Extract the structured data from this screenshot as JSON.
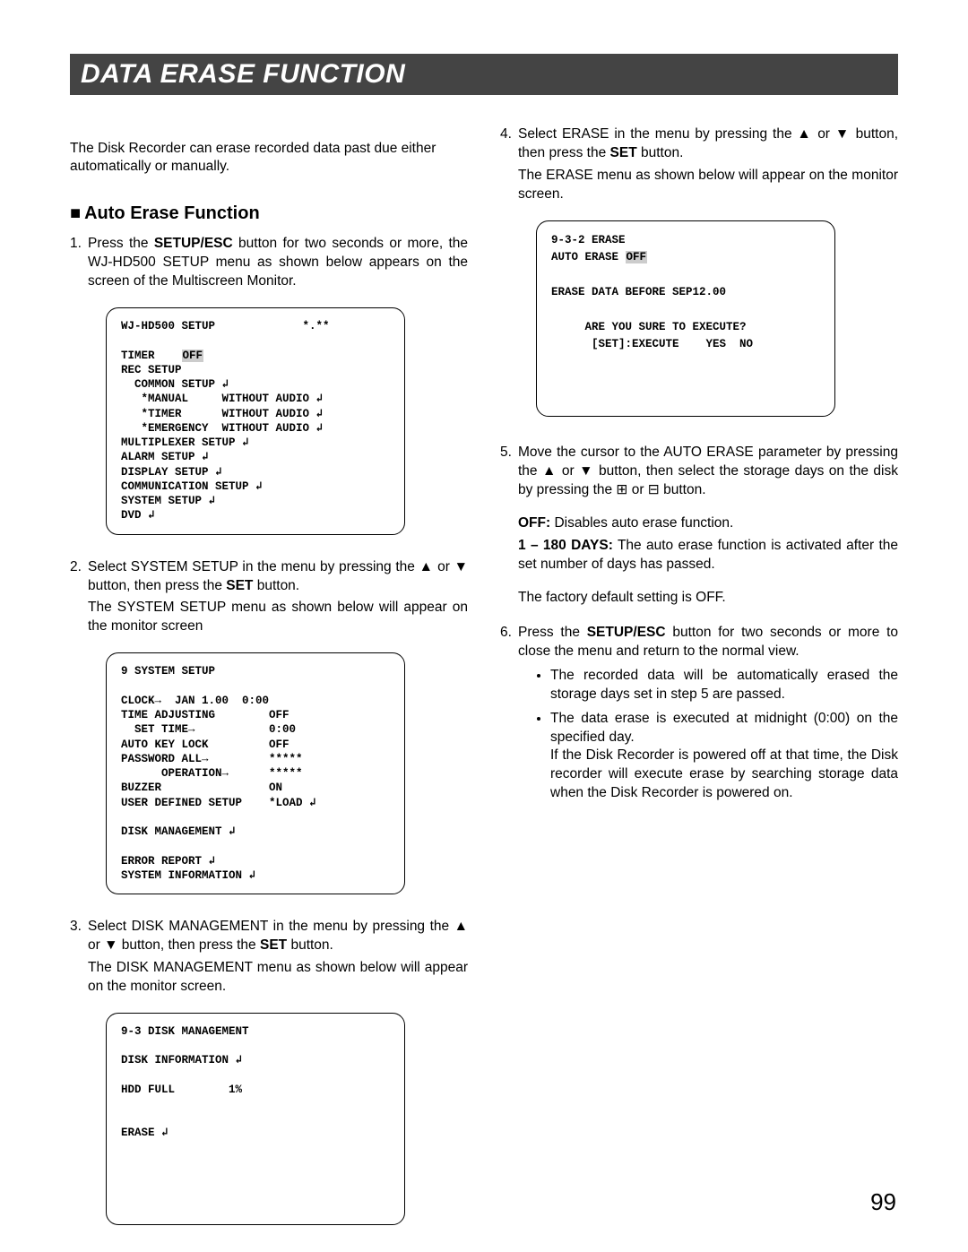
{
  "page": {
    "title": "DATA ERASE FUNCTION",
    "intro": "The Disk Recorder can erase recorded data past due either automatically or manually.",
    "section_heading": "Auto Erase Function",
    "page_number": "99"
  },
  "left": {
    "step1_a": "Press the ",
    "step1_btn": "SETUP/ESC",
    "step1_b": " button for two seconds or more, the WJ-HD500 SETUP menu as shown below appears on the screen of the Multiscreen Monitor.",
    "step2_a": "Select SYSTEM SETUP in the menu by pressing the ▲ or ▼ button, then press the ",
    "step2_btn": "SET",
    "step2_b": " button.",
    "step2_c": "The SYSTEM SETUP menu as shown below will appear on the monitor screen",
    "step3_a": "Select DISK MANAGEMENT in the menu by pressing the ▲ or ▼ button, then press the ",
    "step3_btn": "SET",
    "step3_b": " button.",
    "step3_c": "The DISK MANAGEMENT menu as shown below will appear on the monitor screen."
  },
  "right": {
    "step4_a": "Select ERASE in the menu by pressing the ▲ or ▼ button, then press the ",
    "step4_btn": "SET",
    "step4_b": " button.",
    "step4_c": "The ERASE menu as shown below will appear on the monitor screen.",
    "step5": "Move the cursor to the AUTO ERASE parameter by pressing the ▲ or ▼ button, then select the storage days on the disk by pressing the ⊞ or ⊟ button.",
    "off_label": "OFF:",
    "off_text": " Disables auto erase function.",
    "days_label": "1 – 180 DAYS:",
    "days_text": " The auto erase function is activated after the set number of days has passed.",
    "factory": "The factory default setting is OFF.",
    "step6_a": "Press the ",
    "step6_btn": "SETUP/ESC",
    "step6_b": " button for two seconds or more to close the menu and return to the normal view.",
    "bullet1": "The recorded data will be automatically erased the storage days set in step 5 are passed.",
    "bullet2": "The data erase is executed at midnight (0:00) on the specified day.",
    "bullet2b": "If the Disk Recorder is powered off at that time, the Disk recorder will execute erase by searching storage data when the Disk Recorder is powered on."
  },
  "screens": {
    "s1_pre": "WJ-HD500 SETUP             *.**\n\nTIMER    ",
    "s1_hl": "OFF",
    "s1_post": "\nREC SETUP\n  COMMON SETUP ↲\n   *MANUAL     WITHOUT AUDIO ↲\n   *TIMER      WITHOUT AUDIO ↲\n   *EMERGENCY  WITHOUT AUDIO ↲\nMULTIPLEXER SETUP ↲\nALARM SETUP ↲\nDISPLAY SETUP ↲\nCOMMUNICATION SETUP ↲\nSYSTEM SETUP ↲\nDVD ↲",
    "s2": "9 SYSTEM SETUP\n\nCLOCK→  JAN 1.00  0:00\nTIME ADJUSTING        OFF\n  SET TIME→           0:00\nAUTO KEY LOCK         OFF\nPASSWORD ALL→         *****\n      OPERATION→      *****\nBUZZER                ON\nUSER DEFINED SETUP    *LOAD ↲\n\nDISK MANAGEMENT ↲\n\nERROR REPORT ↲\nSYSTEM INFORMATION ↲",
    "s3": "9-3 DISK MANAGEMENT\n\nDISK INFORMATION ↲\n\nHDD FULL        1%\n\n\nERASE ↲\n\n\n\n\n\n",
    "s4_pre": "9-3-2 ERASE\nAUTO ERASE ",
    "s4_hl": "OFF",
    "s4_post": "\n\nERASE DATA BEFORE SEP12.00\n\n     ARE YOU SURE TO EXECUTE?\n      [SET]:EXECUTE    YES  NO\n\n\n\n"
  }
}
